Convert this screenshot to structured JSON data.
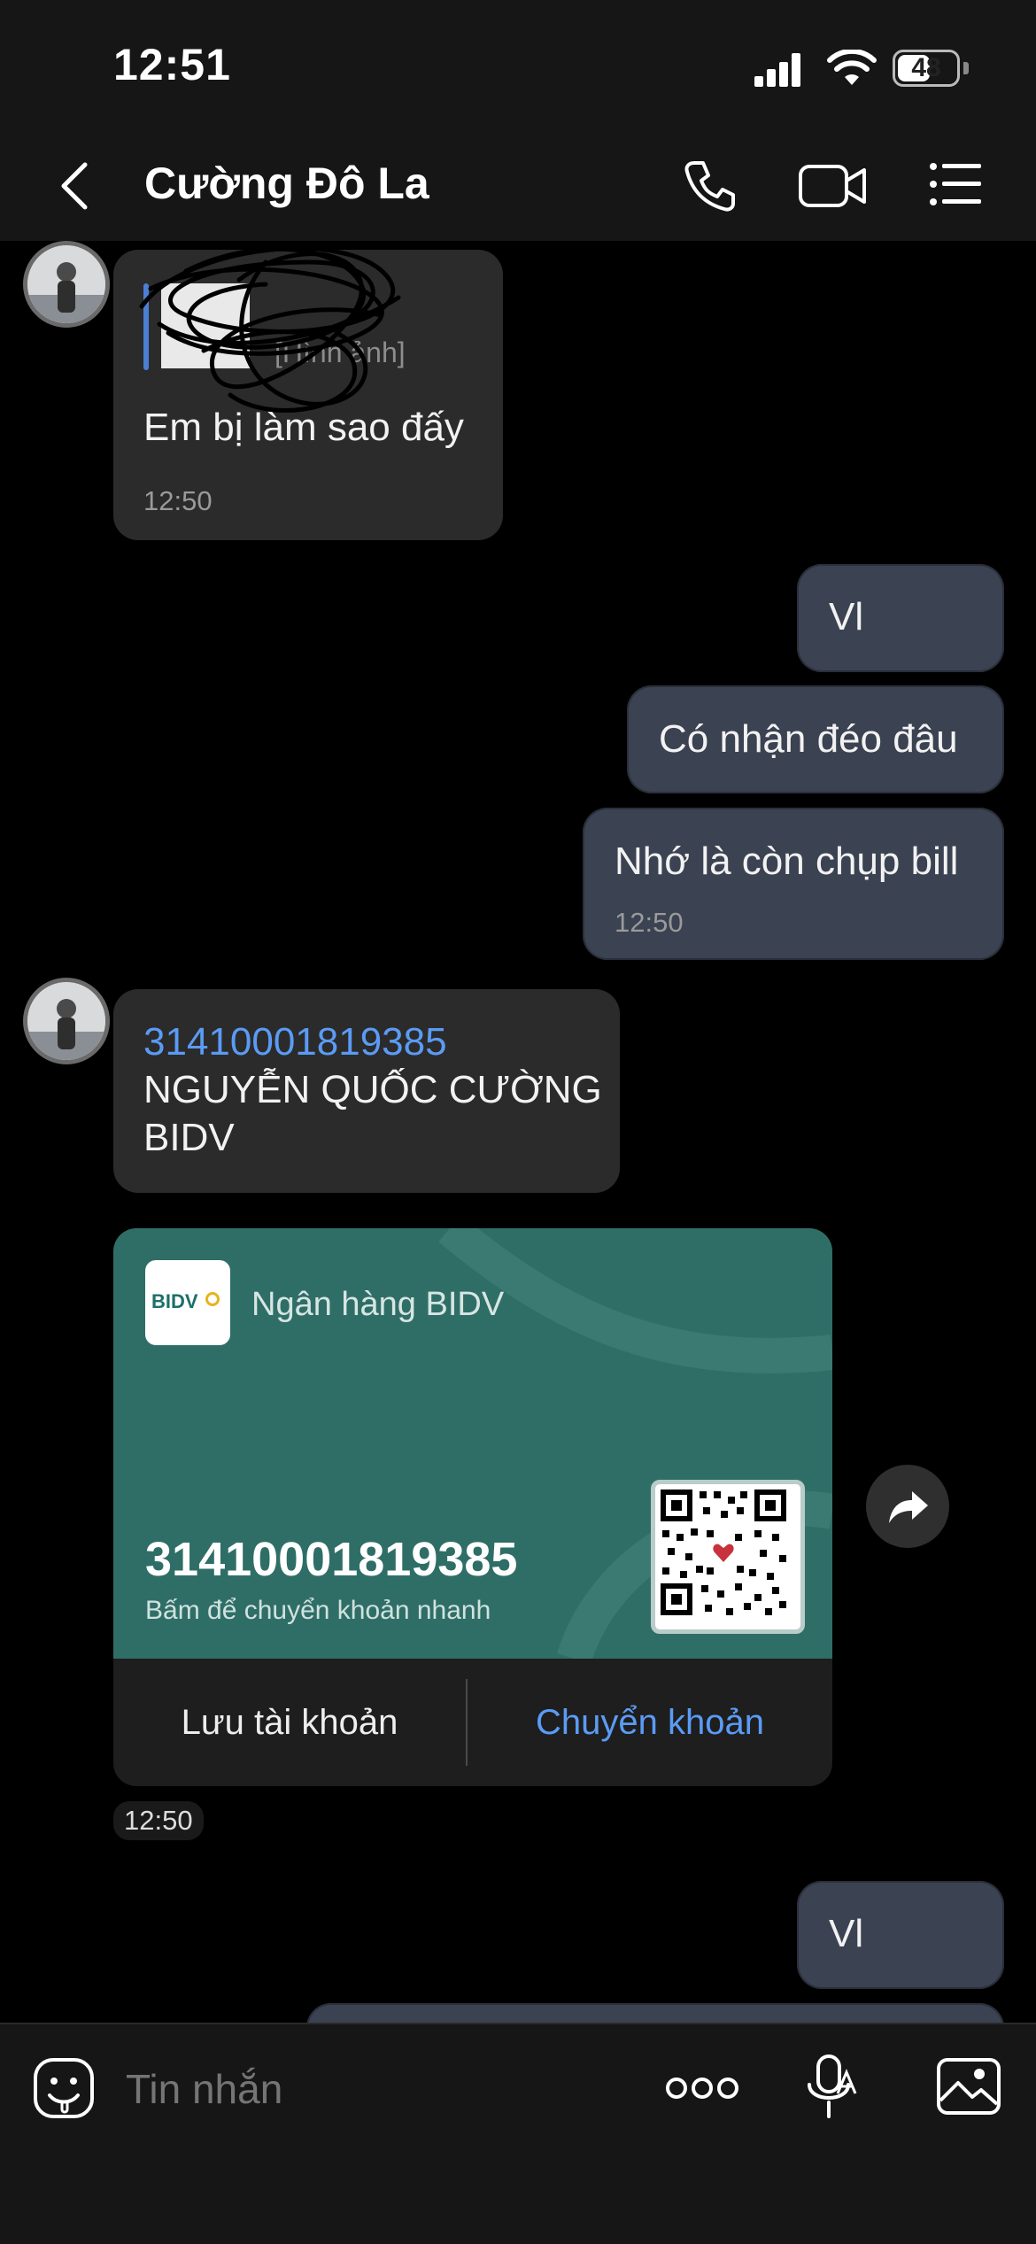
{
  "status_bar": {
    "time": "12:51",
    "battery": "48"
  },
  "header": {
    "contact_name": "Cường Đô La"
  },
  "messages": {
    "m1": {
      "quote_label": "[Hình ảnh]",
      "text": "Em bị làm sao đấy",
      "time": "12:50"
    },
    "m2": {
      "text": "Vl"
    },
    "m3": {
      "text": "Có nhận đéo đâu"
    },
    "m4": {
      "text": "Nhớ là còn chụp bill",
      "time": "12:50"
    },
    "m5": {
      "account_number": "31410001819385",
      "account_name": "NGUYỄN QUỐC CƯỜNG",
      "bank": "BIDV"
    },
    "card": {
      "bank_logo_text": "BIDV",
      "bank_name": "Ngân hàng BIDV",
      "account_number": "31410001819385",
      "hint": "Bấm để chuyển khoản nhanh",
      "save_label": "Lưu tài khoản",
      "transfer_label": "Chuyển khoản",
      "time": "12:50"
    },
    "m6": {
      "text": "Vl"
    }
  },
  "input": {
    "placeholder": "Tin nhắn"
  },
  "icons": {
    "back": "chevron-left-icon",
    "call": "phone-icon",
    "video": "video-camera-icon",
    "menu": "list-icon",
    "share": "share-arrow-icon",
    "emoji": "sticker-icon",
    "more": "more-dots-icon",
    "voice": "voice-to-text-icon",
    "gallery": "image-gallery-icon"
  },
  "colors": {
    "accent": "#5b9bf5",
    "card": "#2f6e67",
    "outgoing": "#3b4252",
    "incoming": "#2b2b2b"
  }
}
